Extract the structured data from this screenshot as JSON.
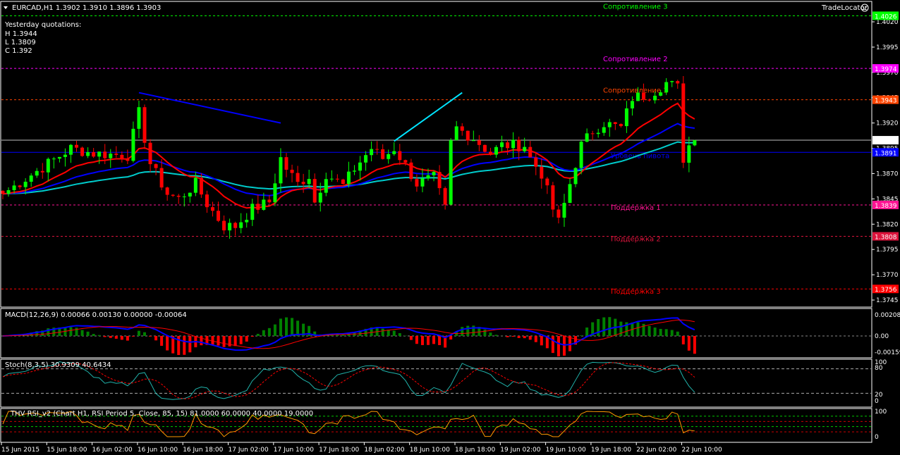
{
  "header": {
    "menu_icon": "triangle-down-icon",
    "title": "EURCAD,H1  1.3902 1.3910 1.3896 1.3903",
    "yesterday_title": "Yesterday quotations:",
    "yesterday_high": "H 1.3944",
    "yesterday_low": "L 1.3809",
    "yesterday_close": "C 1.392",
    "trade_locator": "TradeLocator",
    "trade_locator_icon": "sad-face-icon"
  },
  "levels": [
    {
      "name": "resistance-3",
      "label": "Сопротивление 3",
      "price": 1.4026,
      "badge": "1.4026",
      "color": "#00ff00",
      "style": "dashed"
    },
    {
      "name": "resistance-2",
      "label": "Сопротивление 2",
      "price": 1.3974,
      "badge": "1.3974",
      "color": "#ff00ff",
      "style": "dashed"
    },
    {
      "name": "resistance-1",
      "label": "Сопротивление 1",
      "price": 1.3943,
      "badge": "1.3943",
      "color": "#ff4500",
      "style": "dashed"
    },
    {
      "name": "pivot",
      "label": "Уровень пивота",
      "price": 1.3891,
      "badge": "1.3891",
      "color": "#0000ff",
      "style": "solid"
    },
    {
      "name": "support-1",
      "label": "Поддержка 1",
      "price": 1.3839,
      "badge": "1.3839",
      "color": "#ff1493",
      "style": "dashed"
    },
    {
      "name": "support-2",
      "label": "Поддержка 2",
      "price": 1.3808,
      "badge": "1.3808",
      "color": "#dc143c",
      "style": "dashed"
    },
    {
      "name": "support-3",
      "label": "Поддержка 3",
      "price": 1.3756,
      "badge": "1.3756",
      "color": "#ff0000",
      "style": "dashed"
    }
  ],
  "current_price": {
    "price": 1.3903,
    "badge": "1.3903",
    "color": "#c0c0c0"
  },
  "price_axis": [
    "1.4020",
    "1.3995",
    "1.3970",
    "1.3945",
    "1.3920",
    "1.3895",
    "1.3870",
    "1.3845",
    "1.3820",
    "1.3795",
    "1.3770",
    "1.3745"
  ],
  "time_axis": [
    "15 Jun 2015",
    "15 Jun 18:00",
    "16 Jun 02:00",
    "16 Jun 10:00",
    "16 Jun 18:00",
    "17 Jun 02:00",
    "17 Jun 10:00",
    "17 Jun 18:00",
    "18 Jun 02:00",
    "18 Jun 10:00",
    "18 Jun 18:00",
    "19 Jun 02:00",
    "19 Jun 10:00",
    "19 Jun 18:00",
    "22 Jun 02:00",
    "22 Jun 10:00"
  ],
  "macd": {
    "label": "MACD(12,26,9) 0.00066 0.00130 0.00000 -0.00064",
    "axis": [
      "0.00208",
      "0.00",
      "-0.00159"
    ]
  },
  "stoch": {
    "label": "Stoch(8,3,5) 30.9309 40.6434",
    "axis": [
      "100",
      "80",
      "20",
      "0"
    ]
  },
  "rsi": {
    "label": "THV RSI_v2   (Chart H1,  RSI Period 5,  Close,  85,  15)  81.0000 60.0000 40.0000 19.0000",
    "axis": [
      "100",
      "0"
    ]
  },
  "colors": {
    "bull": "#00ff00",
    "bear": "#ff0000",
    "ma_fast": "#ff0000",
    "ma_mid": "#0000ff",
    "ma_slow": "#00cccc",
    "grid_text": "#ffffff"
  },
  "chart_data": {
    "type": "candlestick",
    "symbol": "EURCAD",
    "timeframe": "H1",
    "ylim": [
      1.374,
      1.4035
    ],
    "price_path": [
      [
        0,
        1.385
      ],
      [
        12,
        1.3895
      ],
      [
        16,
        1.389
      ],
      [
        22,
        1.3888
      ],
      [
        24,
        1.393
      ],
      [
        26,
        1.388
      ],
      [
        29,
        1.385
      ],
      [
        31,
        1.3845
      ],
      [
        34,
        1.386
      ],
      [
        36,
        1.384
      ],
      [
        39,
        1.3818
      ],
      [
        41,
        1.3818
      ],
      [
        44,
        1.3835
      ],
      [
        47,
        1.3842
      ],
      [
        49,
        1.3885
      ],
      [
        50,
        1.3875
      ],
      [
        52,
        1.386
      ],
      [
        54,
        1.3868
      ],
      [
        55,
        1.3842
      ],
      [
        57,
        1.387
      ],
      [
        60,
        1.3858
      ],
      [
        62,
        1.3875
      ],
      [
        65,
        1.3895
      ],
      [
        67,
        1.3885
      ],
      [
        69,
        1.3895
      ],
      [
        71,
        1.3878
      ],
      [
        73,
        1.386
      ],
      [
        76,
        1.3866
      ],
      [
        78,
        1.3835
      ],
      [
        79,
        1.39
      ],
      [
        80,
        1.3915
      ],
      [
        83,
        1.3905
      ],
      [
        86,
        1.389
      ],
      [
        88,
        1.3898
      ],
      [
        92,
        1.3898
      ],
      [
        93,
        1.3885
      ],
      [
        95,
        1.387
      ],
      [
        97,
        1.3835
      ],
      [
        98,
        1.3822
      ],
      [
        99,
        1.384
      ],
      [
        101,
        1.388
      ],
      [
        102,
        1.3898
      ],
      [
        104,
        1.3912
      ],
      [
        106,
        1.392
      ],
      [
        109,
        1.3915
      ],
      [
        111,
        1.3945
      ],
      [
        114,
        1.3948
      ],
      [
        117,
        1.396
      ],
      [
        119,
        1.3955
      ],
      [
        120,
        1.3885
      ],
      [
        121,
        1.3898
      ],
      [
        122,
        1.3903
      ]
    ],
    "trendlines": [
      {
        "name": "trendline-blue",
        "color": "#0000ff",
        "from": [
          24,
          1.395
        ],
        "to": [
          49,
          1.392
        ]
      },
      {
        "name": "trendline-cyan",
        "color": "#00e5ff",
        "from": [
          69,
          1.3902
        ],
        "to": [
          81,
          1.395
        ]
      }
    ]
  }
}
